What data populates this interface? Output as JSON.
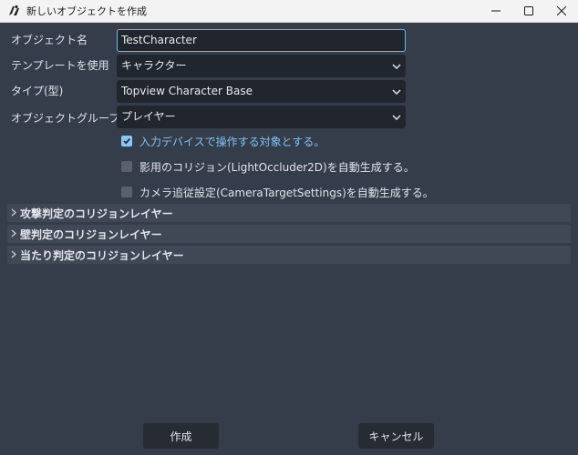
{
  "window": {
    "title": "新しいオブジェクトを作成"
  },
  "form": {
    "object_name_label": "オブジェクト名",
    "object_name_value": "TestCharacter",
    "template_label": "テンプレートを使用",
    "template_value": "キャラクター",
    "type_label": "タイプ(型)",
    "type_value": "Topview Character Base",
    "group_label": "オブジェクトグループ",
    "group_value": "プレイヤー"
  },
  "checkboxes": [
    {
      "label": "入力デバイスで操作する対象とする。",
      "checked": true
    },
    {
      "label": "影用のコリジョン(LightOccluder2D)を自動生成する。",
      "checked": false
    },
    {
      "label": "カメラ追従設定(CameraTargetSettings)を自動生成する。",
      "checked": false
    }
  ],
  "sections": [
    {
      "label": "攻撃判定のコリジョンレイヤー"
    },
    {
      "label": "壁判定のコリジョンレイヤー"
    },
    {
      "label": "当たり判定のコリジョンレイヤー"
    }
  ],
  "buttons": {
    "create": "作成",
    "cancel": "キャンセル"
  },
  "icons": {
    "app": "app-icon",
    "minimize": "minimize-icon",
    "maximize": "maximize-icon",
    "close": "close-icon",
    "dropdown": "chevron-down-icon",
    "section": "chevron-right-icon",
    "check": "checkmark-icon"
  },
  "colors": {
    "accent": "#6fb6ec",
    "checked_label": "#7fc0f5",
    "background": "#363d4a",
    "field": "#21262e"
  }
}
